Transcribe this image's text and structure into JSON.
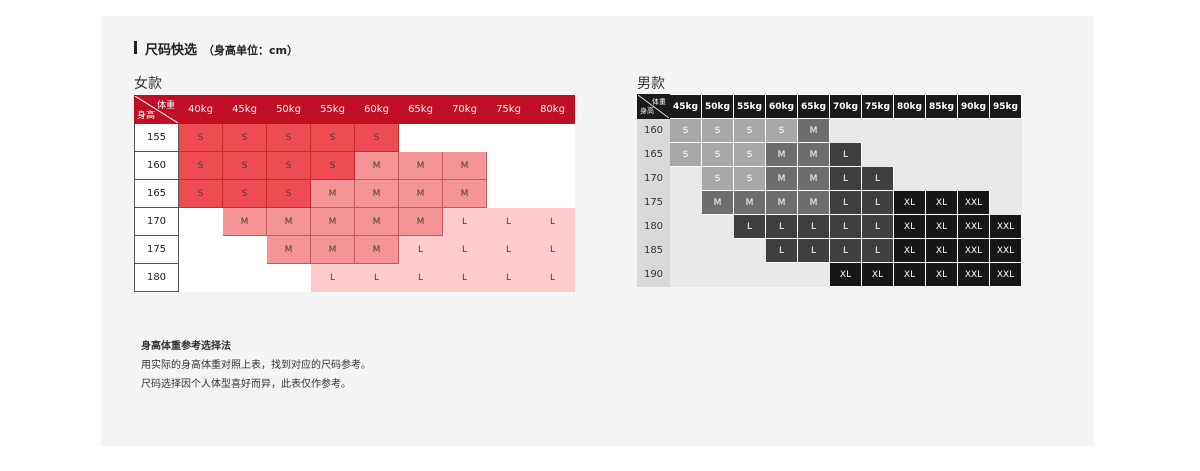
{
  "header": {
    "title": "尺码快选",
    "subtitle": "（身高单位：cm）"
  },
  "women": {
    "caption": "女款",
    "corner_weight": "体重",
    "corner_height": "身高",
    "weights": [
      "40kg",
      "45kg",
      "50kg",
      "55kg",
      "60kg",
      "65kg",
      "70kg",
      "75kg",
      "80kg"
    ],
    "rows": [
      {
        "height": "155",
        "cells": [
          "S",
          "S",
          "S",
          "S",
          "S",
          "",
          "",
          "",
          ""
        ]
      },
      {
        "height": "160",
        "cells": [
          "S",
          "S",
          "S",
          "S",
          "M",
          "M",
          "M",
          "",
          ""
        ]
      },
      {
        "height": "165",
        "cells": [
          "S",
          "S",
          "S",
          "M",
          "M",
          "M",
          "M",
          "",
          ""
        ]
      },
      {
        "height": "170",
        "cells": [
          "",
          "M",
          "M",
          "M",
          "M",
          "M",
          "L",
          "L",
          "L"
        ]
      },
      {
        "height": "175",
        "cells": [
          "",
          "",
          "M",
          "M",
          "M",
          "L",
          "L",
          "L",
          "L"
        ]
      },
      {
        "height": "180",
        "cells": [
          "",
          "",
          "",
          "L",
          "L",
          "L",
          "L",
          "L",
          "L"
        ]
      }
    ]
  },
  "men": {
    "caption": "男款",
    "corner_weight": "体重",
    "corner_height": "身高",
    "weights": [
      "45kg",
      "50kg",
      "55kg",
      "60kg",
      "65kg",
      "70kg",
      "75kg",
      "80kg",
      "85kg",
      "90kg",
      "95kg"
    ],
    "rows": [
      {
        "height": "160",
        "cells": [
          "S",
          "S",
          "S",
          "S",
          "M",
          "",
          "",
          "",
          "",
          "",
          ""
        ]
      },
      {
        "height": "165",
        "cells": [
          "S",
          "S",
          "S",
          "M",
          "M",
          "L",
          "",
          "",
          "",
          "",
          ""
        ]
      },
      {
        "height": "170",
        "cells": [
          "",
          "S",
          "S",
          "M",
          "M",
          "L",
          "L",
          "",
          "",
          "",
          ""
        ]
      },
      {
        "height": "175",
        "cells": [
          "",
          "M",
          "M",
          "M",
          "M",
          "L",
          "L",
          "XL",
          "XL",
          "XXL",
          ""
        ]
      },
      {
        "height": "180",
        "cells": [
          "",
          "",
          "L",
          "L",
          "L",
          "L",
          "L",
          "XL",
          "XL",
          "XXL",
          "XXL"
        ]
      },
      {
        "height": "185",
        "cells": [
          "",
          "",
          "",
          "L",
          "L",
          "L",
          "L",
          "XL",
          "XL",
          "XXL",
          "XXL"
        ]
      },
      {
        "height": "190",
        "cells": [
          "",
          "",
          "",
          "",
          "",
          "XL",
          "XL",
          "XL",
          "XL",
          "XXL",
          "XXL"
        ]
      }
    ]
  },
  "notes": {
    "title": "身高体重参考选择法",
    "line1": "用实际的身高体重对照上表，找到对应的尺码参考。",
    "line2": "尺码选择因个人体型喜好而异，此表仅作参考。"
  },
  "colors": {
    "women_header": "#c00e25",
    "women_s": "#ee4b52",
    "women_m": "#f49496",
    "women_l": "#fdcbcc",
    "men_header": "#1a1a1a",
    "men_s": "#a8a8a8",
    "men_m": "#6e6e6e",
    "men_l": "#3f3f3f",
    "men_xl": "#161616"
  }
}
